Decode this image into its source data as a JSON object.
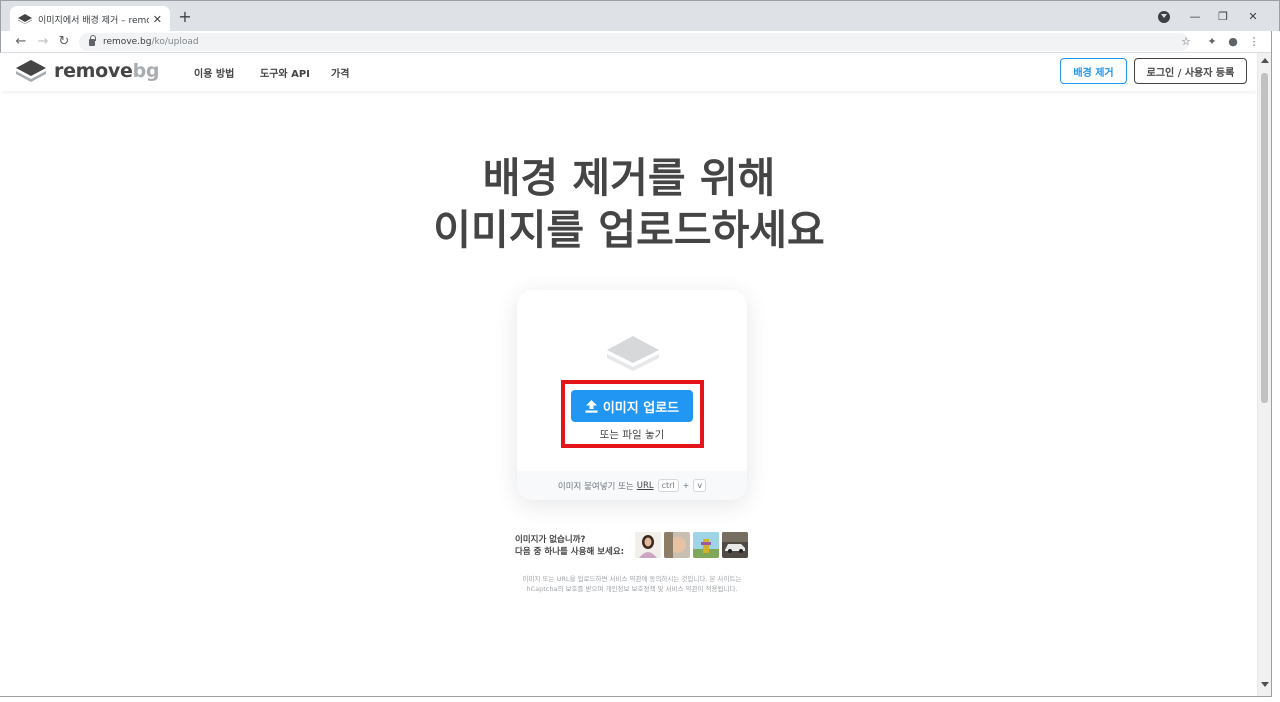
{
  "browser": {
    "tab_title": "이미지에서 배경 제거 – remove.bg",
    "url_host": "remove.bg",
    "url_path": "/ko/upload"
  },
  "header": {
    "logo_text_main": "remove",
    "logo_text_accent": "bg",
    "nav": [
      "이용 방법",
      "도구와 API",
      "가격"
    ],
    "remove_bg_button": "배경 제거",
    "login_button": "로그인 / 사용자 등록"
  },
  "hero": {
    "title_line1": "배경 제거를 위해",
    "title_line2": "이미지를 업로드하세요"
  },
  "upload": {
    "button_label": "이미지 업로드",
    "drop_text": "또는 파일 놓기",
    "paste_prefix": "이미지 붙여넣기 또는",
    "paste_url": "URL",
    "key_ctrl": "ctrl",
    "key_plus": "+",
    "key_v": "v"
  },
  "samples": {
    "line1": "이미지가 없습니까?",
    "line2": "다음 중 하나를 사용해 보세요:",
    "thumbnails": [
      "sample-woman",
      "sample-baby",
      "sample-fire-hydrant",
      "sample-car"
    ]
  },
  "legal": {
    "line1": "이미지 또는 URL을 업로드하면 서비스 약관에 동의하시는 것입니다. 본 사이트는",
    "line2": "hCaptcha의 보호를 받으며 개인정보 보호정책 및 서비스 약관이 적용됩니다."
  },
  "colors": {
    "accent": "#2196f3",
    "text": "#454545",
    "highlight": "#e4141b"
  }
}
